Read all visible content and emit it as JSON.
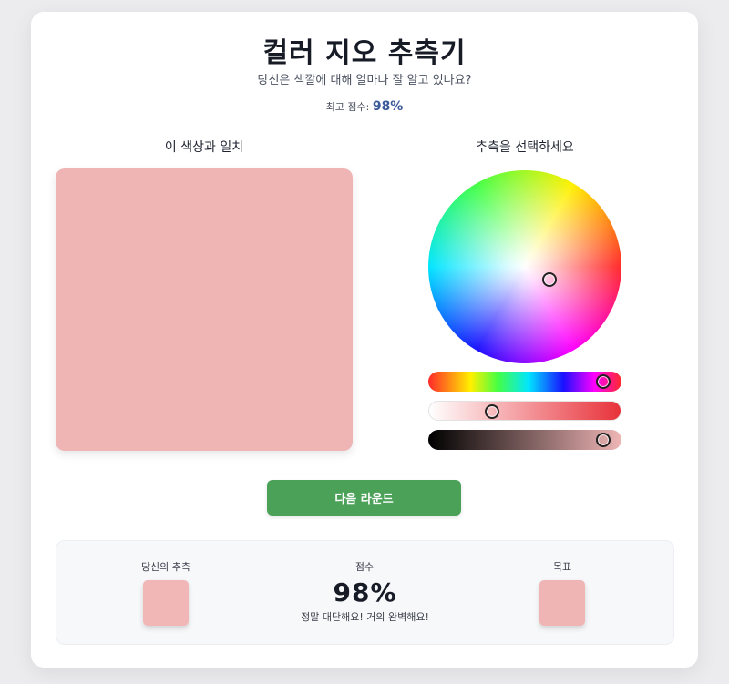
{
  "header": {
    "title": "컬러 지오 추측기",
    "subtitle": "당신은 색깔에 대해 얼마나 잘 알고 있나요?",
    "best_label": "최고 점수:",
    "best_value": "98%"
  },
  "target": {
    "label": "이 색상과 일치",
    "color": "#efb5b5"
  },
  "picker": {
    "label": "추측을 선택하세요",
    "hue_level": 0.94,
    "saturation_level": 0.31,
    "brightness_level": 0.94
  },
  "actions": {
    "next_label": "다음 라운드"
  },
  "results": {
    "guess_label": "당신의 추측",
    "guess_color": "#f1b7b7",
    "score_label": "점수",
    "score_value": "98%",
    "message": "정말 대단해요! 거의 완벽해요!",
    "target_label": "목표",
    "target_color": "#efb5b5"
  },
  "colors": {
    "accent_green": "#4aa157",
    "score_blue": "#3a5a9a"
  }
}
